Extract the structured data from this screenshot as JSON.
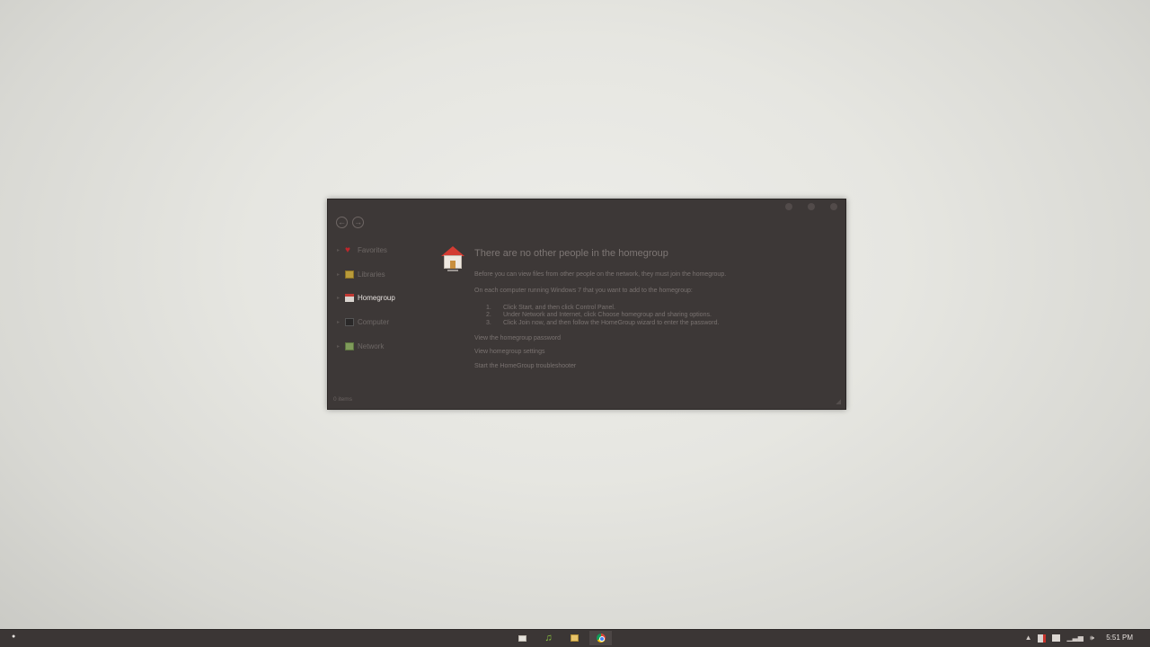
{
  "window": {
    "controls": [
      "minimize",
      "maximize",
      "close"
    ],
    "nav": {
      "back_icon": "back-arrow-icon",
      "forward_icon": "forward-arrow-icon"
    },
    "sidebar": {
      "items": [
        {
          "label": "Favorites",
          "icon": "heart-icon",
          "active": false
        },
        {
          "label": "Libraries",
          "icon": "library-icon",
          "active": false
        },
        {
          "label": "Homegroup",
          "icon": "homegroup-icon",
          "active": true
        },
        {
          "label": "Computer",
          "icon": "computer-icon",
          "active": false
        },
        {
          "label": "Network",
          "icon": "network-icon",
          "active": false
        }
      ]
    },
    "main": {
      "headline": "There are no other people in the homegroup",
      "paragraph1": "Before you can view files from other people on the network, they must join the homegroup.",
      "paragraph2": "On each computer running Windows 7 that you want to add to the homegroup:",
      "steps": [
        {
          "num": "1.",
          "text": "Click Start, and then click Control Panel."
        },
        {
          "num": "2.",
          "text": "Under Network and Internet, click Choose homegroup and sharing options."
        },
        {
          "num": "3.",
          "text": "Click Join now, and then follow the HomeGroup wizard to enter the password."
        }
      ],
      "links": [
        "View the homegroup password",
        "View homegroup settings",
        "Start the HomeGroup troubleshooter"
      ]
    },
    "status": "0 items"
  },
  "taskbar": {
    "pinned": [
      "explorer-icon",
      "music-player-icon",
      "folder-icon",
      "chrome-icon"
    ],
    "active_index": 3,
    "tray": {
      "show_hidden": "▲",
      "volume": "🕪"
    },
    "clock": "5:51 PM"
  },
  "colors": {
    "window_bg": "#3d3837",
    "taskbar_bg": "#3b3635",
    "accent_red": "#c0262b"
  }
}
